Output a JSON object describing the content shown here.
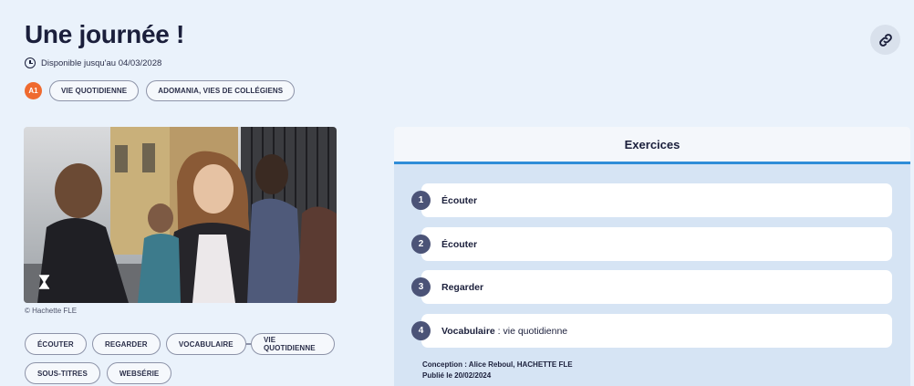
{
  "header": {
    "title": "Une journée !",
    "availability": "Disponible jusqu'au 04/03/2028",
    "link_icon": "link-icon"
  },
  "tags": {
    "level": "A1",
    "items": [
      "VIE QUOTIDIENNE",
      "ADOMANIA, VIES DE COLLÉGIENS"
    ]
  },
  "media": {
    "credit": "© Hachette FLE",
    "icon": "hourglass-icon"
  },
  "keywords": [
    "ÉCOUTER",
    "REGARDER",
    "VOCABULAIRE",
    "VIE QUOTIDIENNE",
    "SOUS-TITRES",
    "WEBSÉRIE"
  ],
  "exercises": {
    "title": "Exercices",
    "items": [
      {
        "number": "1",
        "label": "Écouter",
        "detail": ""
      },
      {
        "number": "2",
        "label": "Écouter",
        "detail": ""
      },
      {
        "number": "3",
        "label": "Regarder",
        "detail": ""
      },
      {
        "number": "4",
        "label": "Vocabulaire",
        "detail": " : vie quotidienne"
      }
    ],
    "conception": "Conception : Alice Reboul, HACHETTE FLE",
    "published": "Publié le 20/02/2024"
  },
  "colors": {
    "background": "#eaf2fb",
    "level_badge": "#ef6a2f",
    "accent": "#2f8dd8",
    "number_badge": "#4b5377"
  }
}
